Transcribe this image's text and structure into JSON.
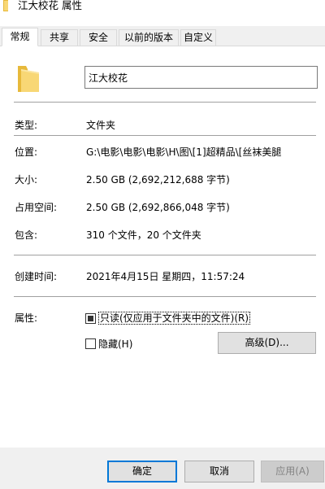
{
  "window": {
    "title": "江大校花 属性"
  },
  "tabs": [
    {
      "label": "常规",
      "active": true
    },
    {
      "label": "共享",
      "active": false
    },
    {
      "label": "安全",
      "active": false
    },
    {
      "label": "以前的版本",
      "active": false
    },
    {
      "label": "自定义",
      "active": false
    }
  ],
  "general": {
    "folder_name": "江大校花",
    "type_label": "类型:",
    "type_value": "文件夹",
    "location_label": "位置:",
    "location_value": "G:\\电影\\电影\\电影\\H\\图\\[1]超精品\\[丝袜美腿",
    "size_label": "大小:",
    "size_value": "2.50 GB (2,692,212,688 字节)",
    "size_on_disk_label": "占用空间:",
    "size_on_disk_value": "2.50 GB (2,692,866,048 字节)",
    "contains_label": "包含:",
    "contains_value": "310 个文件，20 个文件夹",
    "created_label": "创建时间:",
    "created_value": "2021年4月15日 星期四，11:57:24",
    "attributes_label": "属性:",
    "readonly_label": "只读(仅应用于文件夹中的文件)(R)",
    "readonly_state": "indeterminate",
    "hidden_label": "隐藏(H)",
    "hidden_checked": false,
    "advanced_button": "高级(D)..."
  },
  "footer": {
    "ok_button": "确定",
    "cancel_button": "取消",
    "apply_button": "应用(A)",
    "apply_enabled": false
  },
  "colors": {
    "folder": "#f8d775",
    "folder_dark": "#e7b93b",
    "focus_border": "#0078d7"
  },
  "icons": {
    "title_icon": "folder-icon",
    "big_icon": "folder-icon"
  }
}
